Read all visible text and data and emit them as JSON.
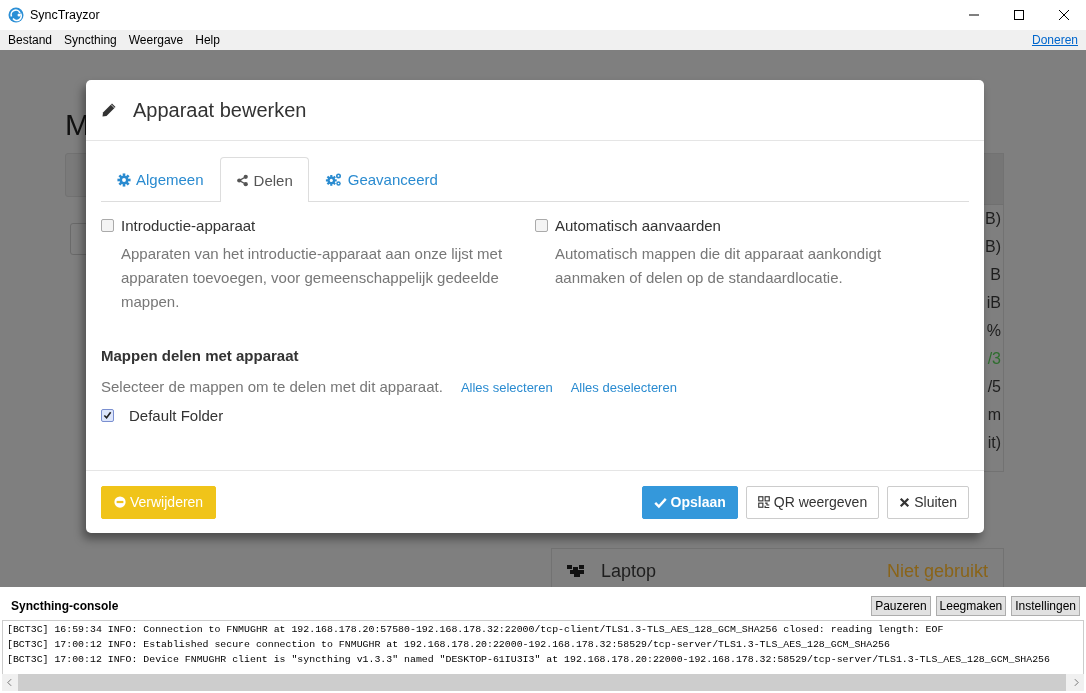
{
  "window": {
    "title": "SyncTrayzor"
  },
  "menu": {
    "items": [
      "Bestand",
      "Syncthing",
      "Weergave",
      "Help"
    ],
    "donate_link": "Doneren"
  },
  "background": {
    "heading": "M",
    "column_fragments": [
      {
        "text": "B)",
        "color": "#1e1e1e"
      },
      {
        "text": "B)",
        "color": "#1e1e1e"
      },
      {
        "text": "B",
        "color": "#1e1e1e"
      },
      {
        "text": "iB",
        "color": "#1e1e1e"
      },
      {
        "text": "%",
        "color": "#1e1e1e"
      },
      {
        "text": "/3",
        "color": "#2e6e2e"
      },
      {
        "text": "/5",
        "color": "#1e1e1e"
      },
      {
        "text": "m",
        "color": "#1e1e1e"
      },
      {
        "text": "it)",
        "color": "#1e1e1e"
      }
    ],
    "device": {
      "name": "Laptop",
      "status": "Niet gebruikt"
    }
  },
  "dialog": {
    "title": "Apparaat bewerken",
    "tabs": [
      {
        "label": "Algemeen",
        "selected": false
      },
      {
        "label": "Delen",
        "selected": true
      },
      {
        "label": "Geavanceerd",
        "selected": false
      }
    ],
    "options": [
      {
        "label": "Introductie-apparaat",
        "checked": false,
        "help": "Apparaten van het introductie-apparaat aan onze lijst met apparaten toevoegen, voor gemeenschappelijk gedeelde mappen."
      },
      {
        "label": "Automatisch aanvaarden",
        "checked": false,
        "help": "Automatisch mappen die dit apparaat aankondigt aanmaken of delen op de standaardlocatie."
      }
    ],
    "section_title": "Mappen delen met apparaat",
    "section_hint": "Selecteer de mappen om te delen met dit apparaat.",
    "links": [
      "Alles selecteren",
      "Alles deselecteren"
    ],
    "folders": [
      {
        "label": "Default Folder",
        "checked": true
      }
    ],
    "buttons": [
      {
        "label": "Verwijderen",
        "kind": "warning"
      },
      {
        "label": "Opslaan",
        "kind": "primary"
      },
      {
        "label": "QR weergeven",
        "kind": "default"
      },
      {
        "label": "Sluiten",
        "kind": "default"
      }
    ]
  },
  "console": {
    "title": "Syncthing-console",
    "buttons": [
      "Pauzeren",
      "Leegmaken",
      "Instellingen"
    ],
    "lines": [
      "[BCT3C] 16:59:34 INFO: Connection to FNMUGHR at 192.168.178.20:57580-192.168.178.32:22000/tcp-client/TLS1.3-TLS_AES_128_GCM_SHA256 closed: reading length: EOF",
      "[BCT3C] 17:00:12 INFO: Established secure connection to FNMUGHR at 192.168.178.20:22000-192.168.178.32:58529/tcp-server/TLS1.3-TLS_AES_128_GCM_SHA256",
      "[BCT3C] 17:00:12 INFO: Device FNMUGHR client is \"syncthing v1.3.3\" named \"DESKTOP-61IU3I3\" at 192.168.178.20:22000-192.168.178.32:58529/tcp-server/TLS1.3-TLS_AES_128_GCM_SHA256"
    ]
  }
}
